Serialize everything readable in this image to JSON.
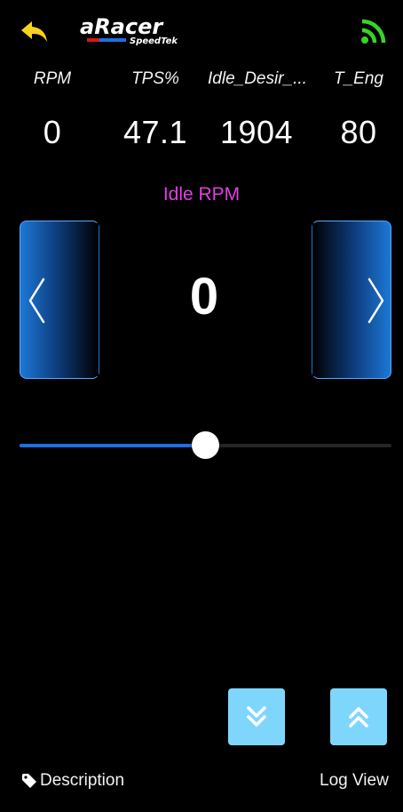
{
  "header": {
    "logo_main": "aRacer",
    "logo_sub": "SpeedTek"
  },
  "gauges": [
    {
      "label": "RPM",
      "value": "0"
    },
    {
      "label": "TPS%",
      "value": "47.1"
    },
    {
      "label": "Idle_Desir_...",
      "value": "1904"
    },
    {
      "label": "T_Eng",
      "value": "80"
    }
  ],
  "idle": {
    "title": "Idle RPM",
    "value": "0"
  },
  "slider": {
    "level": 0.5
  },
  "footer": {
    "description_label": "Description",
    "log_view_label": "Log View"
  },
  "icons": {
    "back": "back-arrow-icon",
    "wifi": "wifi-signal-icon",
    "left": "chevron-left-icon",
    "right": "chevron-right-icon",
    "down": "double-chevron-down-icon",
    "up": "double-chevron-up-icon",
    "tag": "tag-icon"
  },
  "colors": {
    "back_icon": "#f7d21e",
    "wifi_icon": "#38d32a",
    "title": "#e040e0",
    "accent": "#1f6fe0",
    "nav_button": "#7fd6fd"
  }
}
